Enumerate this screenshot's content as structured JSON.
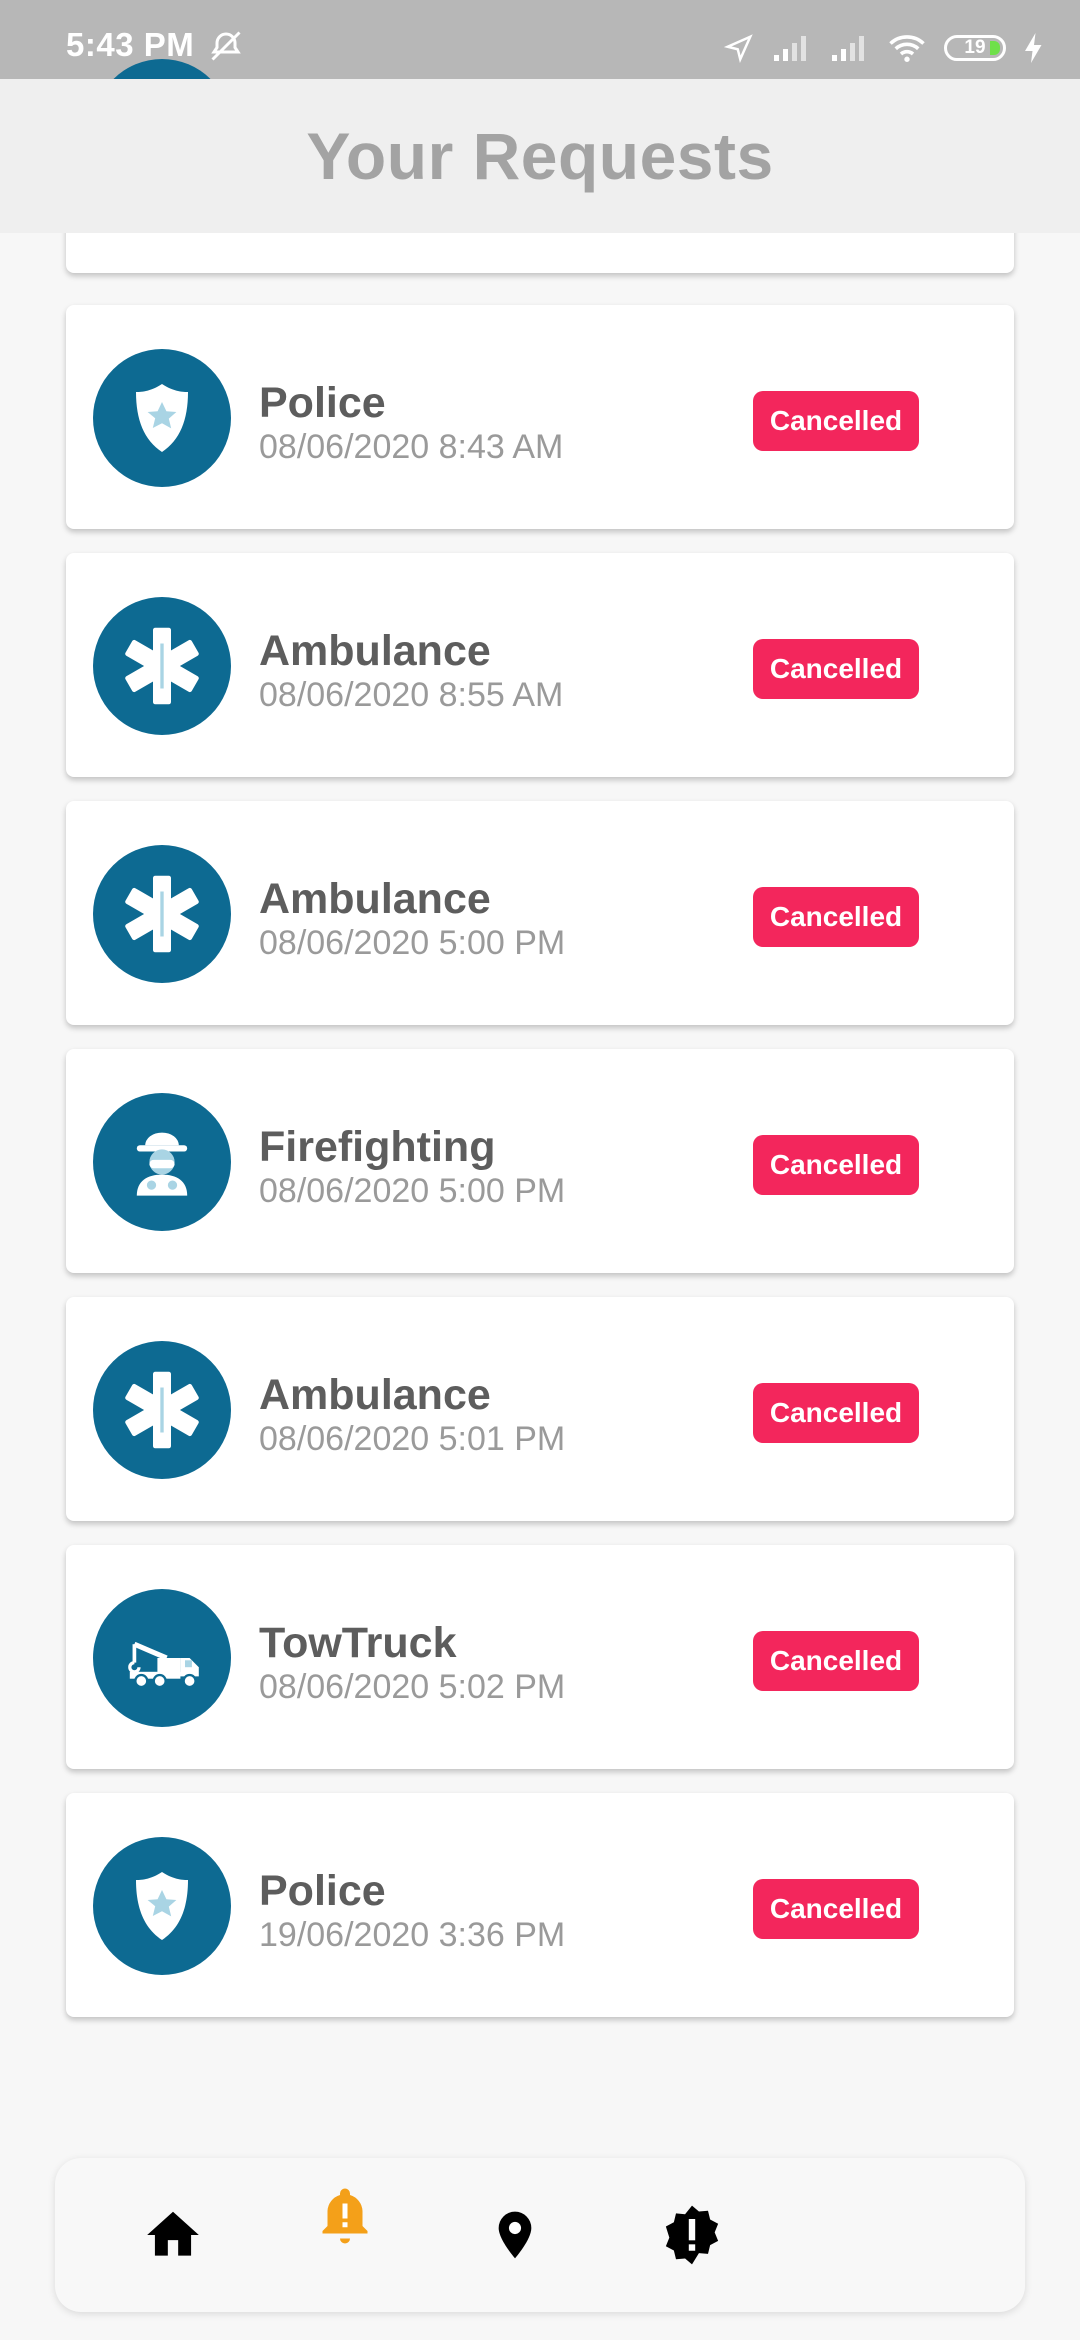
{
  "status_bar": {
    "time": "5:43 PM",
    "battery_level": "19",
    "icons": [
      "mute-alarm-icon",
      "location-arrow-icon",
      "signal-icon",
      "signal-icon",
      "wifi-icon",
      "battery-icon",
      "charging-icon"
    ]
  },
  "header": {
    "title": "Your Requests"
  },
  "requests": [
    {
      "service": "Police",
      "date": "08/06/2020 8:43 AM",
      "status": "Cancelled",
      "icon": "police-badge-icon"
    },
    {
      "service": "Ambulance",
      "date": "08/06/2020 8:55 AM",
      "status": "Cancelled",
      "icon": "star-of-life-icon"
    },
    {
      "service": "Ambulance",
      "date": "08/06/2020 5:00 PM",
      "status": "Cancelled",
      "icon": "star-of-life-icon"
    },
    {
      "service": "Firefighting",
      "date": "08/06/2020 5:00 PM",
      "status": "Cancelled",
      "icon": "firefighter-icon"
    },
    {
      "service": "Ambulance",
      "date": "08/06/2020 5:01 PM",
      "status": "Cancelled",
      "icon": "star-of-life-icon"
    },
    {
      "service": "TowTruck",
      "date": "08/06/2020 5:02 PM",
      "status": "Cancelled",
      "icon": "tow-truck-icon"
    },
    {
      "service": "Police",
      "date": "19/06/2020 3:36 PM",
      "status": "Cancelled",
      "icon": "police-badge-icon"
    }
  ],
  "bottom_nav": [
    {
      "name": "home",
      "icon": "home-icon",
      "active": false
    },
    {
      "name": "requests",
      "icon": "alert-bell-icon",
      "active": true
    },
    {
      "name": "location",
      "icon": "map-pin-icon",
      "active": false
    },
    {
      "name": "alerts",
      "icon": "warning-badge-icon",
      "active": false
    }
  ],
  "colors": {
    "avatar_bg": "#0d6a92",
    "avatar_icon": "#a9d4e4",
    "badge": "#f3265c",
    "nav_active": "#f4a019",
    "nav_inactive": "#000000"
  }
}
